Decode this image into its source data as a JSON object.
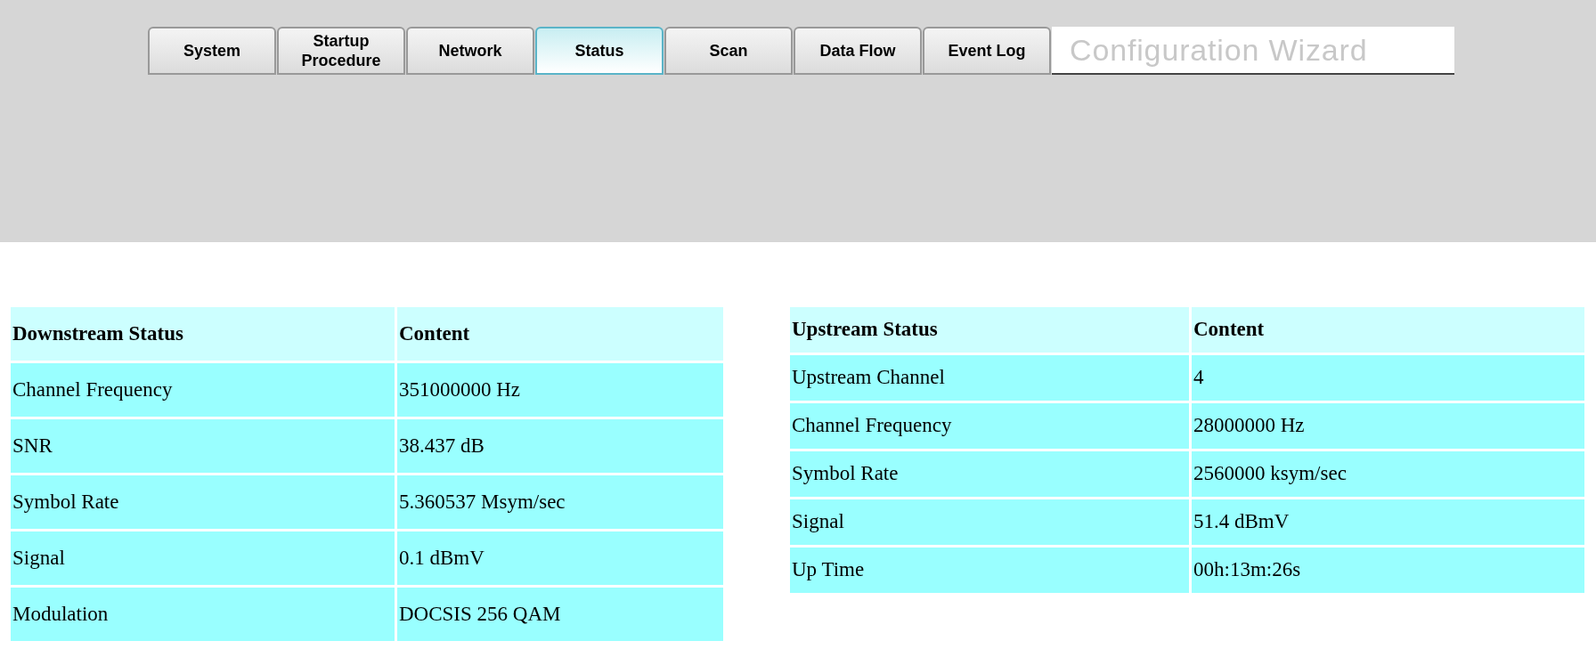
{
  "tabs": [
    {
      "label": "System",
      "selected": false
    },
    {
      "label": "Startup Procedure",
      "selected": false
    },
    {
      "label": "Network",
      "selected": false
    },
    {
      "label": "Status",
      "selected": true
    },
    {
      "label": "Scan",
      "selected": false
    },
    {
      "label": "Data Flow",
      "selected": false
    },
    {
      "label": "Event Log",
      "selected": false
    }
  ],
  "banner_title": "Configuration Wizard",
  "downstream_table": {
    "columns": [
      "Downstream Status",
      "Content"
    ],
    "rows": [
      [
        "Channel Frequency",
        "351000000 Hz"
      ],
      [
        "SNR",
        "38.437 dB"
      ],
      [
        "Symbol Rate",
        "5.360537 Msym/sec"
      ],
      [
        "Signal",
        "0.1 dBmV"
      ],
      [
        "Modulation",
        "DOCSIS 256 QAM"
      ]
    ]
  },
  "upstream_table": {
    "columns": [
      "Upstream Status",
      "Content"
    ],
    "rows": [
      [
        "Upstream Channel",
        "4"
      ],
      [
        "Channel Frequency",
        "28000000 Hz"
      ],
      [
        "Symbol Rate",
        "2560000 ksym/sec"
      ],
      [
        "Signal",
        "51.4 dBmV"
      ],
      [
        "Up Time",
        "00h:13m:26s"
      ]
    ]
  }
}
